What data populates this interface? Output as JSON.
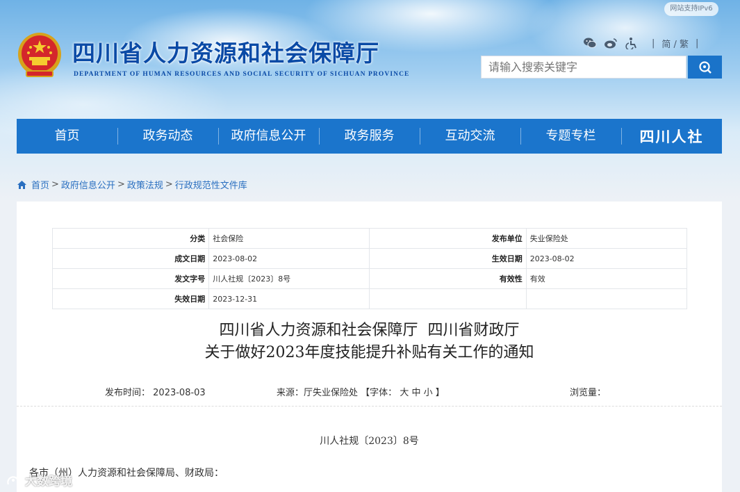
{
  "header": {
    "title": "四川省人力资源和社会保障厅",
    "subtitle": "DEPARTMENT OF HUMAN RESOURCES AND SOCIAL SECURITY OF SICHUAN PROVINCE",
    "ipv6_badge": "网站支持IPv6",
    "lang_switch": "简 / 繁",
    "search_placeholder": "请输入搜索关键字",
    "tool_icons": [
      "wechat-icon",
      "weibo-icon",
      "accessibility-icon"
    ]
  },
  "nav": {
    "items": [
      "首页",
      "政务动态",
      "政府信息公开",
      "政务服务",
      "互动交流",
      "专题专栏"
    ],
    "logo_text": "四川人社"
  },
  "breadcrumb": [
    "首页",
    "政府信息公开",
    "政策法规",
    "行政规范性文件库"
  ],
  "meta": {
    "rows": [
      [
        {
          "k": "分类",
          "v": "社会保险"
        },
        {
          "k": "发布单位",
          "v": "失业保险处"
        }
      ],
      [
        {
          "k": "成文日期",
          "v": "2023-08-02"
        },
        {
          "k": "生效日期",
          "v": "2023-08-02"
        }
      ],
      [
        {
          "k": "发文字号",
          "v": "川人社规〔2023〕8号"
        },
        {
          "k": "有效性",
          "v": "有效"
        }
      ],
      [
        {
          "k": "失效日期",
          "v": "2023-12-31"
        },
        {
          "k": "",
          "v": ""
        }
      ]
    ]
  },
  "article": {
    "title_line1": "四川省人力资源和社会保障厅  四川省财政厅",
    "title_line2": "关于做好2023年度技能提升补贴有关工作的通知",
    "publish_label": "发布时间：",
    "publish_date": "2023-08-03",
    "source_label": "来源：",
    "source": "厅失业保险处",
    "font_label": "【字体：",
    "font_large": "大",
    "font_medium": "中",
    "font_small": "小",
    "font_close": "】",
    "views_label": "浏览量：",
    "doc_number": "川人社规〔2023〕8号",
    "salutation": "各市（州）人力资源和社会保障局、财政局："
  },
  "watermark": "大数跨境",
  "colors": {
    "brand_blue": "#1b75cc",
    "title_blue": "#0a4aa6",
    "link_blue": "#2a6fc0"
  }
}
